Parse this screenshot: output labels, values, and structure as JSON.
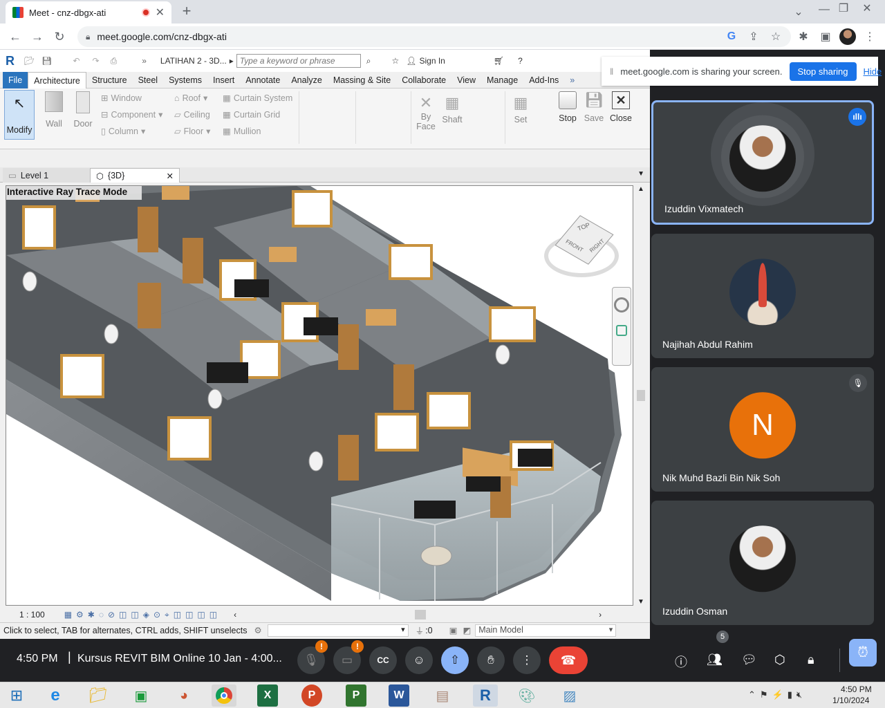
{
  "browser": {
    "tab_title": "Meet - cnz-dbgx-ati",
    "url": "meet.google.com/cnz-dbgx-ati"
  },
  "revit": {
    "title": "LATIHAN 2 - 3D...",
    "search_placeholder": "Type a keyword or phrase",
    "sign_in": "Sign In",
    "menu": [
      "File",
      "Architecture",
      "Structure",
      "Steel",
      "Systems",
      "Insert",
      "Annotate",
      "Analyze",
      "Massing & Site",
      "Collaborate",
      "View",
      "Manage",
      "Add-Ins"
    ],
    "ribbon": {
      "modify": "Modify",
      "wall": "Wall",
      "door": "Door",
      "window": "Window",
      "component": "Component",
      "column": "Column",
      "roof": "Roof",
      "ceiling": "Ceiling",
      "floor": "Floor",
      "curtain_system": "Curtain System",
      "curtain_grid": "Curtain Grid",
      "mullion": "Mullion",
      "by_face": "By\nFace",
      "by": "By",
      "face": "Face",
      "shaft": "Shaft",
      "set": "Set",
      "stop": "Stop",
      "save": "Save",
      "close": "Close"
    },
    "view_tabs": [
      "Level 1",
      "{3D}"
    ],
    "view_mode_label": "Interactive Ray Trace Mode",
    "viewcube": {
      "top": "TOP",
      "front": "FRONT",
      "right": "RIGHT"
    },
    "scale": "1 : 100",
    "status_text": "Click to select, TAB for alternates, CTRL adds, SHIFT unselects",
    "selection_count": ":0",
    "model": "Main Model"
  },
  "meet": {
    "share_notice": "meet.google.com is sharing your screen.",
    "stop_sharing": "Stop sharing",
    "hide": "Hide",
    "participants": [
      {
        "name": "Izuddin Vixmatech",
        "speaking": true
      },
      {
        "name": "Najihah Abdul Rahim"
      },
      {
        "name": "Nik Muhd Bazli Bin Nik Soh",
        "initial": "N",
        "muted": true,
        "color": "#e8710a"
      },
      {
        "name": "Izuddin Osman"
      }
    ],
    "time": "4:50 PM",
    "meeting_title": "Kursus REVIT BIM Online 10 Jan - 4:00...",
    "participant_count": "5",
    "alert_badge": "!"
  },
  "taskbar": {
    "time": "4:50 PM",
    "date": "1/10/2024"
  }
}
